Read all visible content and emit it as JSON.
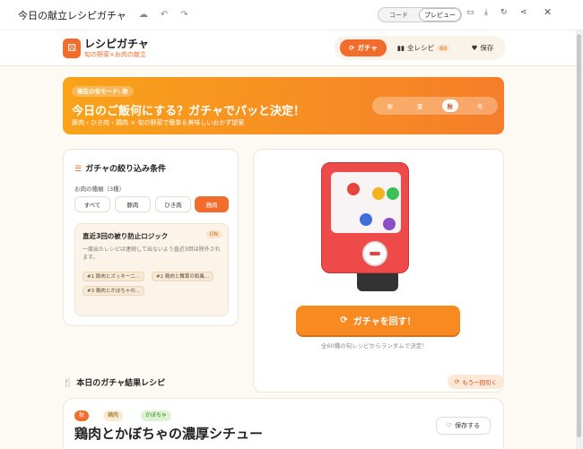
{
  "window": {
    "title": "今日の献立レシピガチャ",
    "view_toggle": [
      "コード",
      "プレビュー"
    ]
  },
  "header": {
    "logo_glyph": "⚄",
    "brand": "レシピガチャ",
    "tagline": "旬の野菜×お肉の献立",
    "nav": {
      "gacha": "ガチャ",
      "all_recipes": "全レシピ",
      "all_count": "60",
      "saved": "保存"
    }
  },
  "banner": {
    "mode": "現在の旬モード: 秋",
    "headline": "今日のご飯何にする？ガチャでパッと決定！",
    "sub": "豚肉・ひき肉・鶏肉 × 旬の野菜で簡単＆美味しいおかず提案",
    "seasons": [
      "春",
      "夏",
      "秋",
      "冬"
    ],
    "active_season": "秋"
  },
  "filter": {
    "title": "ガチャの絞り込み条件",
    "meat_label": "お肉の種類（3種）",
    "chips": [
      "すべて",
      "豚肉",
      "ひき肉",
      "鶏肉"
    ],
    "active_chip": "鶏肉",
    "logic": {
      "title": "直近3回の被り防止ロジック",
      "badge": "ON",
      "desc": "一度出たレシピは連続して出ないよう直近3回は除外されます。",
      "history": [
        "#1 豚肉とズッキーニ...",
        "#2 鶏肉と舞茸の和風...",
        "#3 鶏肉とかぼちゃの..."
      ]
    }
  },
  "gacha": {
    "button": "ガチャを回す！",
    "note": "全60種の旬レシピからランダムで決定！",
    "balls": [
      "#e2463d",
      "#f4b21c",
      "#3cc156",
      "#3f6fd8",
      "#8a4fc7"
    ]
  },
  "results": {
    "title": "本日のガチャ結果レシピ",
    "another": "もう一回引く",
    "recipe": {
      "tags": [
        "秋",
        "鶏肉",
        "かぼちゃ"
      ],
      "name": "鶏肉とかぼちゃの濃厚シチュー",
      "save": "保存する"
    }
  },
  "colors": {
    "accent": "#f26c2b",
    "banner_start": "#f9a21a",
    "banner_end": "#f57e2a",
    "machine": "#ee4a4a"
  }
}
